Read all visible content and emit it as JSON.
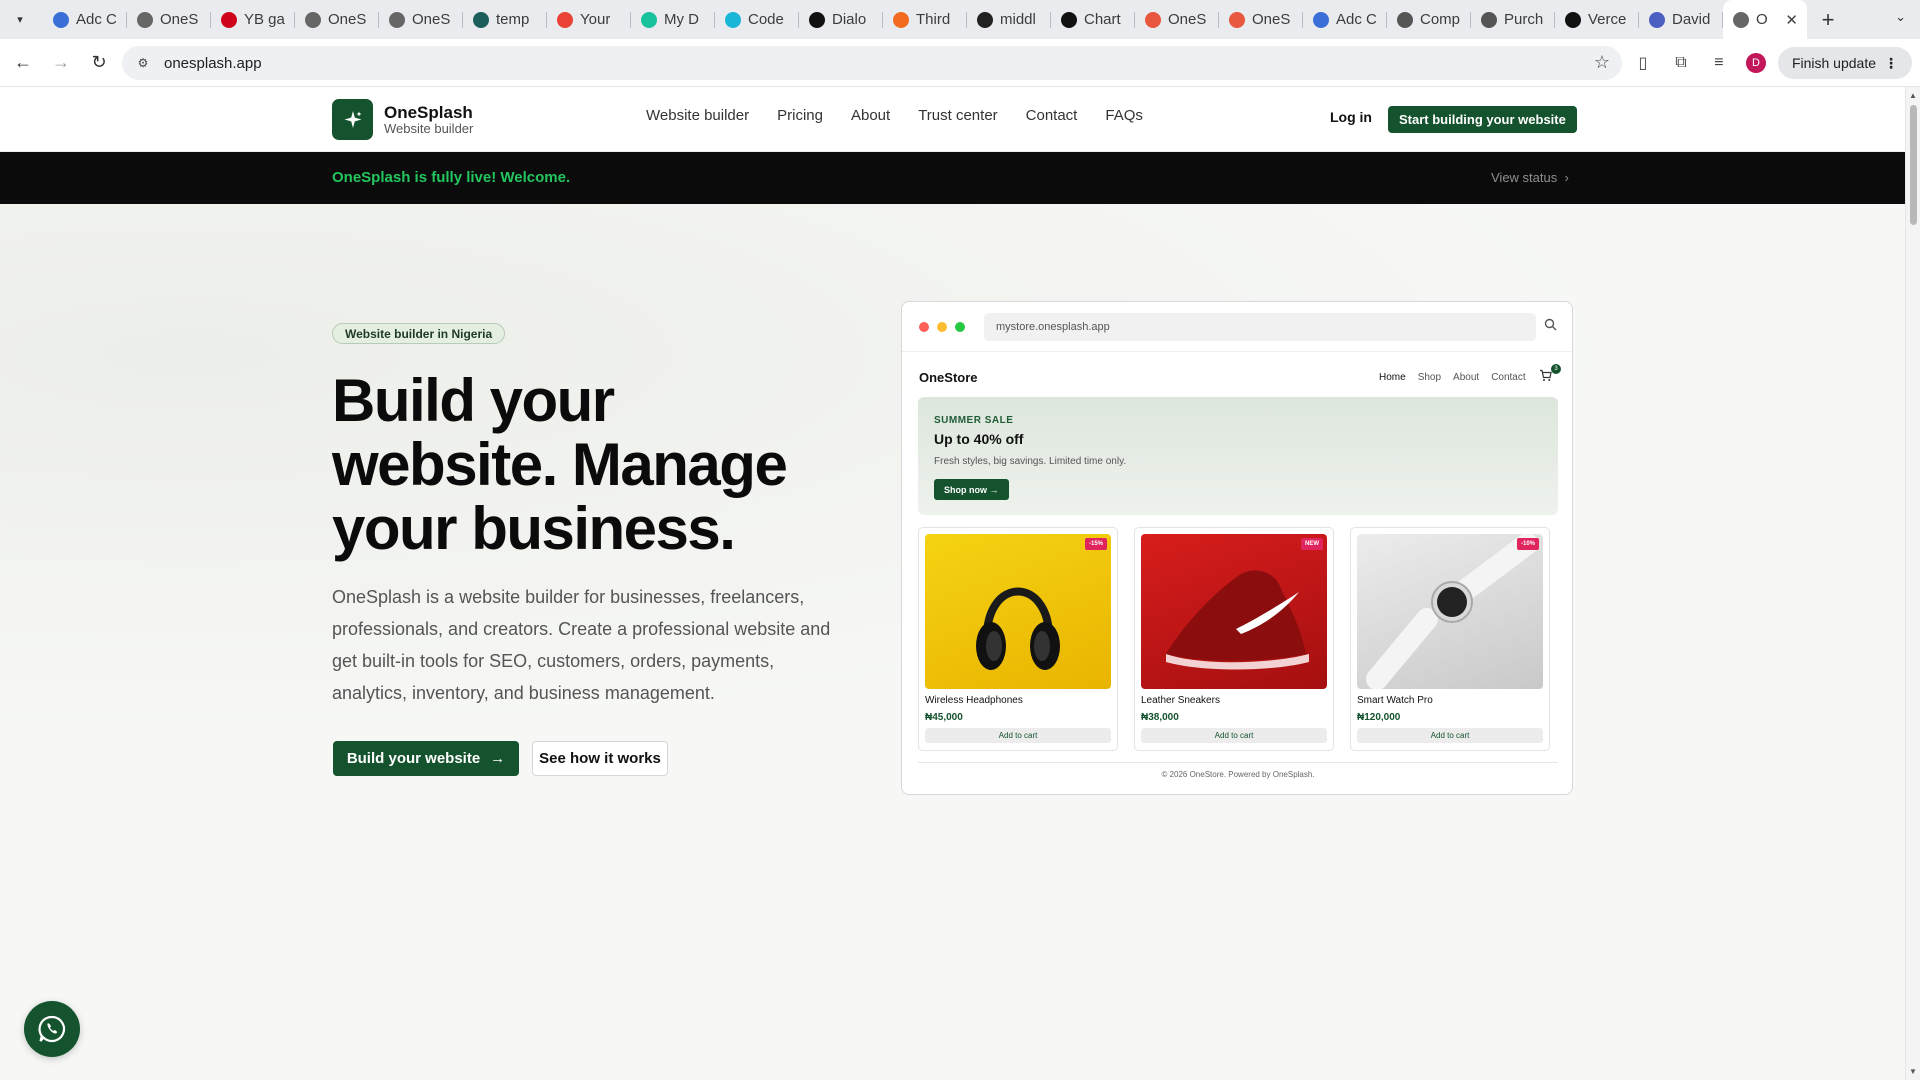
{
  "browser": {
    "tabs": [
      {
        "label": "Adc C",
        "fav_color": "#3b6fd8",
        "fav_icon": "adc-icon"
      },
      {
        "label": "OneS",
        "fav_color": "#666666",
        "fav_icon": "sparkle-icon"
      },
      {
        "label": "YB ga",
        "fav_color": "#d0021b",
        "fav_icon": "yb-icon"
      },
      {
        "label": "OneS",
        "fav_color": "#666666",
        "fav_icon": "sparkle-icon"
      },
      {
        "label": "OneS",
        "fav_color": "#666666",
        "fav_icon": "sparkle-icon"
      },
      {
        "label": "temp",
        "fav_color": "#1b5e5a",
        "fav_icon": "globe-icon"
      },
      {
        "label": "Your",
        "fav_color": "#ea4335",
        "fav_icon": "gmail-icon"
      },
      {
        "label": "My D",
        "fav_color": "#18c29c",
        "fav_icon": "note-icon"
      },
      {
        "label": "Code",
        "fav_color": "#1ab6d8",
        "fav_icon": "code-icon"
      },
      {
        "label": "Dialo",
        "fav_color": "#111111",
        "fav_icon": "dialog-icon"
      },
      {
        "label": "Third",
        "fav_color": "#f26b21",
        "fav_icon": "flame-icon"
      },
      {
        "label": "middl",
        "fav_color": "#222222",
        "fav_icon": "github-icon"
      },
      {
        "label": "Chart",
        "fav_color": "#111111",
        "fav_icon": "chart-icon"
      },
      {
        "label": "OneS",
        "fav_color": "#e8573f",
        "fav_icon": "star-icon"
      },
      {
        "label": "OneS",
        "fav_color": "#e8573f",
        "fav_icon": "star-icon"
      },
      {
        "label": "Adc C",
        "fav_color": "#3b6fd8",
        "fav_icon": "adc-icon"
      },
      {
        "label": "Comp",
        "fav_color": "#555555",
        "fav_icon": "openai-icon"
      },
      {
        "label": "Purch",
        "fav_color": "#555555",
        "fav_icon": "openai-icon"
      },
      {
        "label": "Verce",
        "fav_color": "#111111",
        "fav_icon": "vercel-icon"
      },
      {
        "label": "David",
        "fav_color": "#4a5fc1",
        "fav_icon": "people-icon"
      },
      {
        "label": "O",
        "fav_color": "#666666",
        "fav_icon": "sparkle-icon",
        "active": true
      }
    ],
    "url": "onesplash.app",
    "profile_initial": "D",
    "finish_update": "Finish update"
  },
  "site": {
    "brand_name": "OneSplash",
    "brand_sub": "Website builder",
    "nav": [
      "Website builder",
      "Pricing",
      "About",
      "Trust center",
      "Contact",
      "FAQs"
    ],
    "login": "Log in",
    "cta": "Start building your website",
    "announcement": "OneSplash is fully live! Welcome.",
    "view_status": "View status",
    "accent": "#14532d",
    "live_color": "#22c55e"
  },
  "hero": {
    "badge": "Website builder in Nigeria",
    "headline": "Build your website. Manage your business.",
    "lede": "OneSplash is a website builder for businesses, freelancers, professionals, and creators. Create a professional website and get built-in tools for SEO, customers, orders, payments, analytics, inventory, and business management.",
    "primary_button": "Build your website",
    "secondary_button": "See how it works"
  },
  "preview": {
    "url": "mystore.onesplash.app",
    "store_name": "OneStore",
    "nav": [
      "Home",
      "Shop",
      "About",
      "Contact"
    ],
    "cart_count": "3",
    "banner": {
      "eyebrow": "SUMMER SALE",
      "title": "Up to 40% off",
      "desc": "Fresh styles, big savings. Limited time only.",
      "button": "Shop now →"
    },
    "products": [
      {
        "name": "Wireless Headphones",
        "price": "₦45,000",
        "tag": "-15%",
        "add": "Add to cart"
      },
      {
        "name": "Leather Sneakers",
        "price": "₦38,000",
        "tag": "NEW",
        "add": "Add to cart"
      },
      {
        "name": "Smart Watch Pro",
        "price": "₦120,000",
        "tag": "-10%",
        "add": "Add to cart"
      }
    ],
    "footer": "© 2026 OneStore. Powered by OneSplash."
  }
}
